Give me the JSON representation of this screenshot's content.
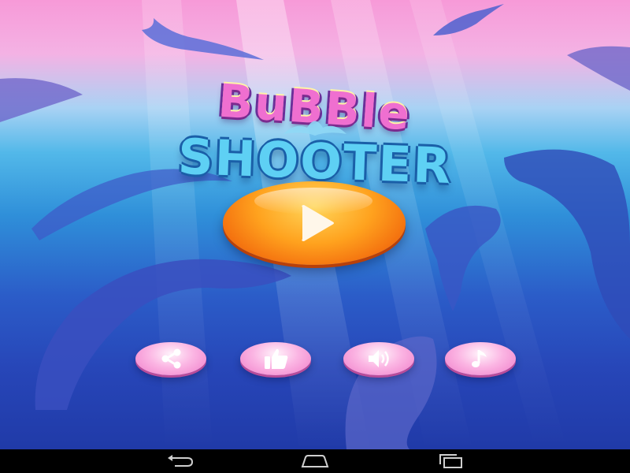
{
  "game": {
    "title_line1": "BuBBle",
    "title_line2": "SHOOTER"
  },
  "buttons": {
    "play": {
      "icon": "play-icon"
    },
    "share": {
      "icon": "share-icon"
    },
    "like": {
      "icon": "thumbs-up-icon"
    },
    "sound": {
      "icon": "speaker-icon"
    },
    "music": {
      "icon": "music-note-icon"
    }
  },
  "system_nav": {
    "back": "back-icon",
    "home": "home-icon",
    "recents": "recents-icon"
  },
  "colors": {
    "play_button": "#f7891a",
    "round_buttons": "#f59bd6",
    "title_pink": "#ef6fd0",
    "title_blue": "#5ed0f4"
  }
}
